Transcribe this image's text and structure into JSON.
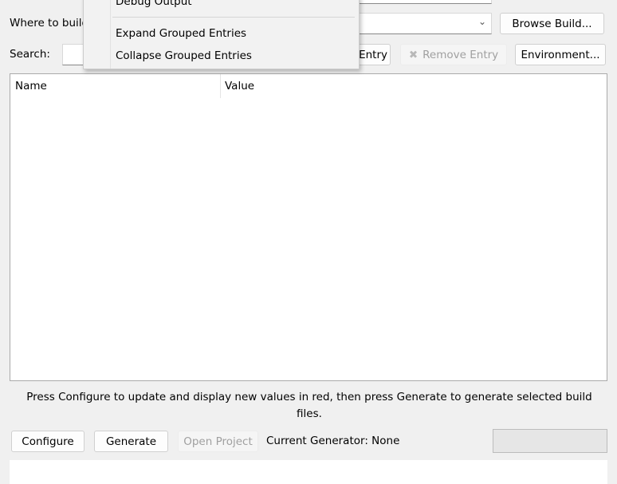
{
  "where_build": {
    "label": "Where to build the binaries:",
    "value": "",
    "browse_label": "Browse Build..."
  },
  "search": {
    "label": "Search:",
    "value": ""
  },
  "toolbar": {
    "add_entry_label": "Add Entry",
    "remove_entry_label": "Remove Entry",
    "environment_label": "Environment..."
  },
  "table": {
    "columns": [
      "Name",
      "Value"
    ],
    "rows": []
  },
  "hint": "Press Configure to update and display new values in red, then press Generate to generate selected build files.",
  "actions": {
    "configure_label": "Configure",
    "generate_label": "Generate",
    "open_project_label": "Open Project",
    "current_generator": "Current Generator: None"
  },
  "progress": 0,
  "menu": {
    "items": [
      "Debug Output",
      "Expand Grouped Entries",
      "Collapse Grouped Entries"
    ]
  }
}
